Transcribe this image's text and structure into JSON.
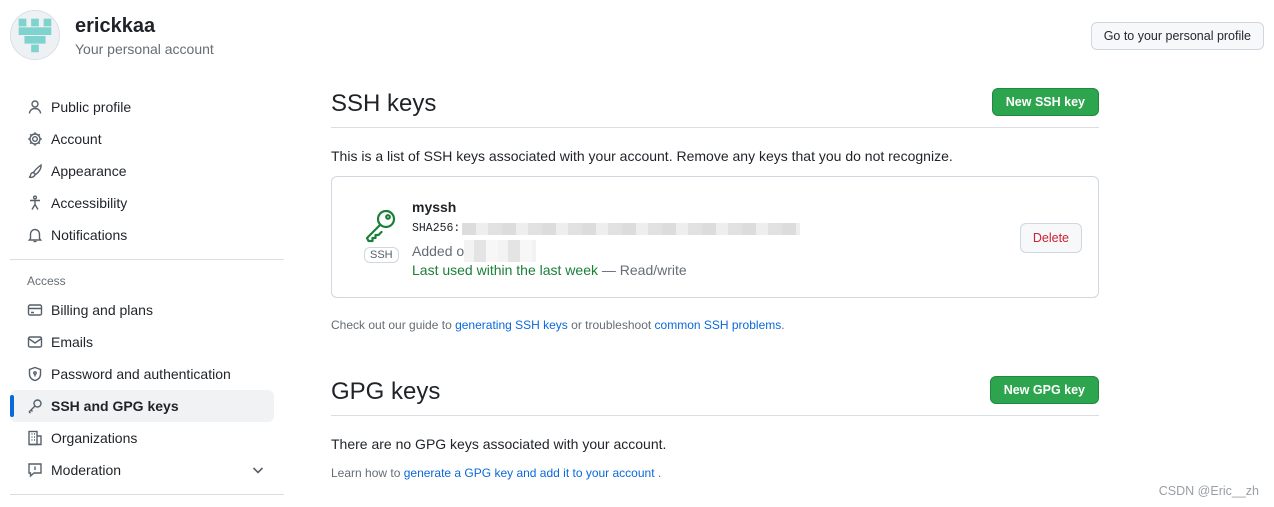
{
  "header": {
    "username": "erickkaa",
    "subtitle": "Your personal account",
    "profile_button": "Go to your personal profile"
  },
  "sidebar": {
    "items": [
      {
        "label": "Public profile",
        "icon": "person-icon"
      },
      {
        "label": "Account",
        "icon": "gear-icon"
      },
      {
        "label": "Appearance",
        "icon": "paintbrush-icon"
      },
      {
        "label": "Accessibility",
        "icon": "accessibility-icon"
      },
      {
        "label": "Notifications",
        "icon": "bell-icon"
      }
    ],
    "access_title": "Access",
    "access_items": [
      {
        "label": "Billing and plans",
        "icon": "credit-card-icon"
      },
      {
        "label": "Emails",
        "icon": "mail-icon"
      },
      {
        "label": "Password and authentication",
        "icon": "shield-lock-icon"
      },
      {
        "label": "SSH and GPG keys",
        "icon": "key-icon",
        "active": true
      },
      {
        "label": "Organizations",
        "icon": "organization-icon"
      },
      {
        "label": "Moderation",
        "icon": "report-icon"
      }
    ]
  },
  "ssh": {
    "title": "SSH keys",
    "new_button": "New SSH key",
    "intro": "This is a list of SSH keys associated with your account. Remove any keys that you do not recognize.",
    "key": {
      "badge": "SSH",
      "name": "myssh",
      "fingerprint_prefix": "SHA256:",
      "added_prefix": "Added o",
      "last_used": "Last used within the last week",
      "access": " — Read/write",
      "delete_button": "Delete"
    },
    "guide_prefix": "Check out our guide to ",
    "guide_link1": "generating SSH keys",
    "guide_mid": " or troubleshoot ",
    "guide_link2": "common SSH problems",
    "guide_suffix": "."
  },
  "gpg": {
    "title": "GPG keys",
    "new_button": "New GPG key",
    "empty_text": "There are no GPG keys associated with your account.",
    "learn_prefix": "Learn how to ",
    "learn_link": "generate a GPG key and add it to your account",
    "learn_suffix": " ."
  },
  "watermark": "CSDN @Eric__zh",
  "colors": {
    "accent_green": "#2da44e",
    "link_blue": "#0969da",
    "danger_red": "#cf222e",
    "active_indicator": "#0969da"
  }
}
